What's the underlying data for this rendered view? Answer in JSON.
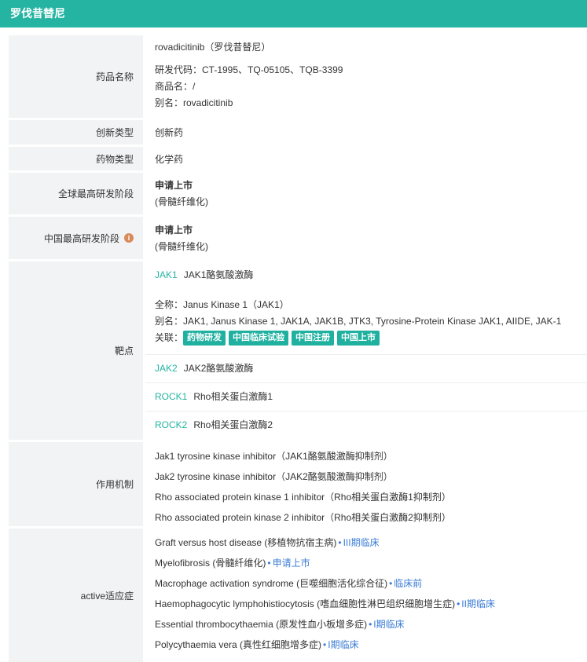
{
  "header": {
    "title": "罗伐昔替尼"
  },
  "drug_name": {
    "label": "药品名称",
    "name": "rovadicitinib（罗伐昔替尼）",
    "code": "研发代码：CT-1995、TQ-05105、TQB-3399",
    "trade": "商品名：/",
    "alias": "别名：rovadicitinib"
  },
  "innovation": {
    "label": "创新类型",
    "value": "创新药"
  },
  "drug_type": {
    "label": "药物类型",
    "value": "化学药"
  },
  "global_stage": {
    "label": "全球最高研发阶段",
    "stage": "申请上市",
    "note": "(骨髓纤维化)"
  },
  "china_stage": {
    "label": "中国最高研发阶段",
    "icon": "info-icon",
    "stage": "申请上市",
    "note": "(骨髓纤维化)"
  },
  "targets": {
    "label": "靶点",
    "items": [
      {
        "code": "JAK1",
        "name": "JAK1酪氨酸激酶"
      },
      {
        "code": "JAK2",
        "name": "JAK2酪氨酸激酶"
      },
      {
        "code": "ROCK1",
        "name": "Rho相关蛋白激酶1"
      },
      {
        "code": "ROCK2",
        "name": "Rho相关蛋白激酶2"
      }
    ],
    "jak1_detail": {
      "fullname": "全称：Janus Kinase 1（JAK1）",
      "alias": "别名：JAK1, Janus Kinase 1, JAK1A, JAK1B, JTK3, Tyrosine-Protein Kinase JAK1, AIIDE, JAK-1",
      "related_label": "关联：",
      "tags": [
        "药物研发",
        "中国临床试验",
        "中国注册",
        "中国上市"
      ]
    }
  },
  "mechanism": {
    "label": "作用机制",
    "items": [
      "Jak1 tyrosine kinase inhibitor（JAK1酪氨酸激酶抑制剂）",
      "Jak2 tyrosine kinase inhibitor（JAK2酪氨酸激酶抑制剂）",
      "Rho associated protein kinase 1 inhibitor（Rho相关蛋白激酶1抑制剂）",
      "Rho associated protein kinase 2 inhibitor（Rho相关蛋白激酶2抑制剂）"
    ]
  },
  "indications": {
    "label": "active适应症",
    "items": [
      {
        "name": "Graft versus host disease (移植物抗宿主病)",
        "phase": "III期临床"
      },
      {
        "name": "Myelofibrosis (骨髓纤维化)",
        "phase": "申请上市"
      },
      {
        "name": "Macrophage activation syndrome (巨噬细胞活化综合征)",
        "phase": "临床前"
      },
      {
        "name": "Haemophagocytic lymphohistiocytosis (嗜血细胞性淋巴组织细胞增生症)",
        "phase": "II期临床"
      },
      {
        "name": "Essential thrombocythaemia (原发性血小板增多症)",
        "phase": "I期临床"
      },
      {
        "name": "Polycythaemia vera (真性红细胞增多症)",
        "phase": "I期临床"
      }
    ]
  },
  "colors": {
    "accent": "#25b4a2",
    "label_bg": "#f2f3f5",
    "phase": "#3a7bd5",
    "info": "#d98a5a"
  }
}
